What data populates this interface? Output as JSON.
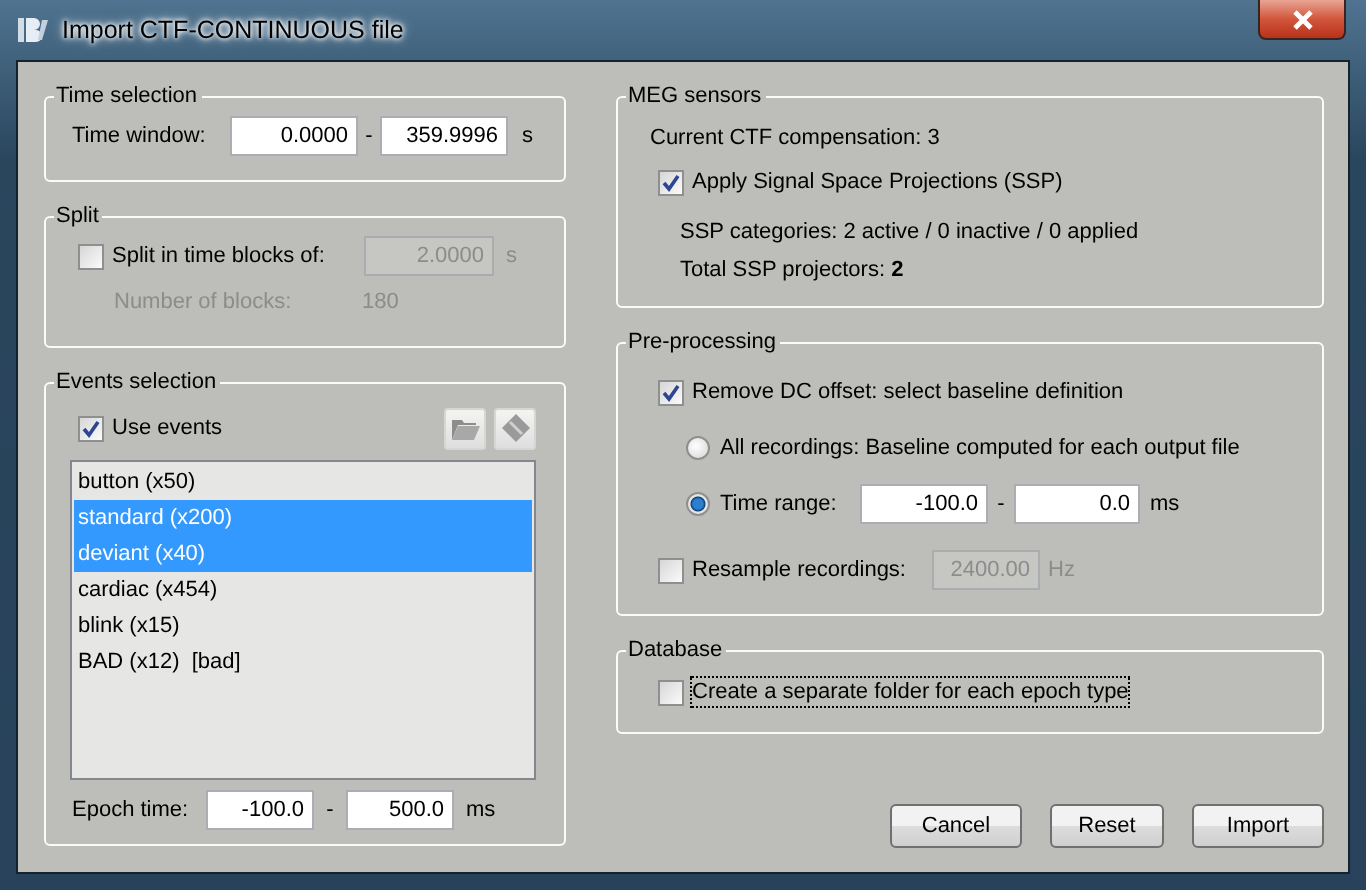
{
  "window": {
    "title": "Import CTF-CONTINUOUS file"
  },
  "time_selection": {
    "title": "Time selection",
    "label": "Time window:",
    "start": "0.0000",
    "separator": "-",
    "end": "359.9996",
    "unit": "s"
  },
  "split": {
    "title": "Split",
    "checkbox": {
      "label": "Split in time blocks of:",
      "checked": false
    },
    "block_length": {
      "value": "2.0000",
      "disabled": true
    },
    "unit": "s",
    "blocks_label": "Number of blocks:",
    "blocks_value": "180"
  },
  "events_selection": {
    "title": "Events selection",
    "use_events": {
      "label": "Use events",
      "checked": true
    },
    "events": [
      {
        "label": "button (x50)",
        "selected": false
      },
      {
        "label": "standard (x200)",
        "selected": true
      },
      {
        "label": "deviant (x40)",
        "selected": true
      },
      {
        "label": "cardiac (x454)",
        "selected": false
      },
      {
        "label": "blink (x15)",
        "selected": false
      },
      {
        "label": "BAD (x12)  [bad]",
        "selected": false
      }
    ],
    "epoch_time": {
      "label": "Epoch time:",
      "start": "-100.0",
      "separator": "-",
      "end": "500.0",
      "unit": "ms"
    }
  },
  "meg_sensors": {
    "title": "MEG sensors",
    "compensation": "Current CTF compensation: 3",
    "ssp": {
      "label": "Apply Signal Space Projections (SSP)",
      "checked": true
    },
    "ssp_categories": "SSP categories: 2 active / 0 inactive / 0 applied",
    "ssp_total": "Total SSP projectors: **2**"
  },
  "pre_processing": {
    "title": "Pre-processing",
    "remove_dc": {
      "label": "Remove DC offset: select baseline definition",
      "checked": true
    },
    "baseline_options": [
      {
        "kind": "plain",
        "label": "All recordings: Baseline computed for each output file",
        "selected": false
      },
      {
        "kind": "range",
        "label": "Time range:",
        "selected": true,
        "start": "-100.0",
        "separator": "-",
        "end": "0.0",
        "unit": "ms"
      }
    ],
    "resample": {
      "label": "Resample recordings:",
      "checked": false,
      "field": {
        "value": "2400.00",
        "disabled": true
      },
      "unit": "Hz"
    }
  },
  "database": {
    "title": "Database",
    "separate_folder": {
      "label": "Create a separate folder for each epoch type",
      "checked": false,
      "focused": true
    }
  },
  "buttons": [
    "Cancel",
    "Reset",
    "Import"
  ]
}
